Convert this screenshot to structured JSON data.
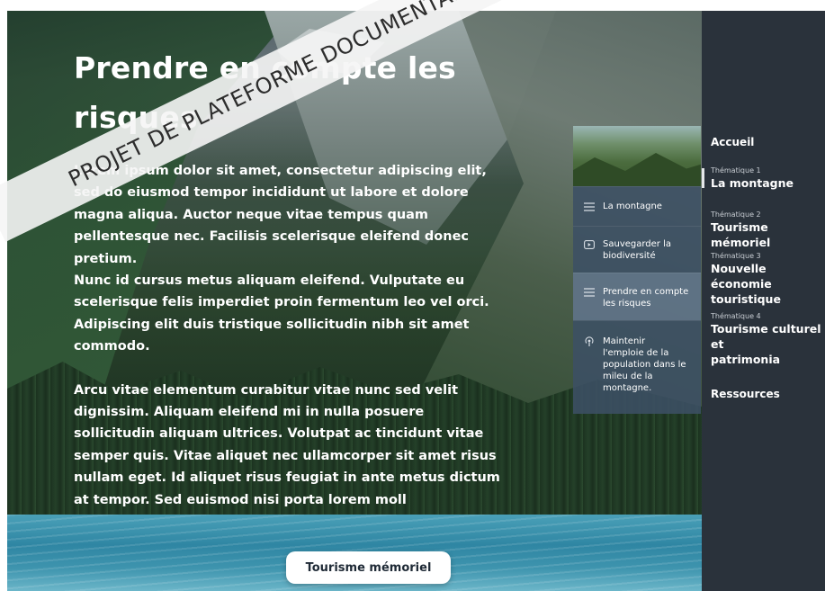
{
  "main": {
    "title": "Prendre en compte les risques",
    "paragraph_1": "Lorem ipsum dolor sit amet, consectetur adipiscing elit,\nsed do eiusmod tempor incididunt ut labore et dolore\nmagna aliqua. Auctor neque vitae tempus quam\npellentesque nec. Facilisis scelerisque eleifend donec\npretium.\nNunc id cursus metus aliquam eleifend. Vulputate eu\nscelerisque felis imperdiet proin fermentum leo vel orci.\nAdipiscing elit duis tristique sollicitudin nibh sit amet\ncommodo.",
    "paragraph_2": "Arcu vitae elementum curabitur vitae nunc sed velit\ndignissim. Aliquam eleifend mi in nulla posuere\nsollicitudin aliquam ultrices. Volutpat ac tincidunt vitae\nsemper quis. Vitae aliquet nec ullamcorper sit amet risus\nnullam eget. Id aliquet risus feugiat in ante metus dictum\nat tempor. Sed euismod nisi porta lorem moll",
    "bottom_button": "Tourisme mémoriel"
  },
  "menu": {
    "items": [
      {
        "label": "La montagne",
        "icon": "menu-lines-icon"
      },
      {
        "label": "Sauvegarder la\nbiodiversité",
        "icon": "play-icon"
      },
      {
        "label": "Prendre en compte\nles risques",
        "icon": "menu-lines-icon"
      },
      {
        "label": "Maintenir\nl'emploie de la\npopulation dans le\nmileu de la\nmontagne.",
        "icon": "podcast-icon"
      }
    ]
  },
  "sidebar": {
    "home": "Accueil",
    "themes": [
      {
        "small": "Thématique 1",
        "label": "La montagne"
      },
      {
        "small": "Thématique 2",
        "label": "Tourisme mémoriel"
      },
      {
        "small": "Thématique 3",
        "label": "Nouvelle économie\ntouristique"
      },
      {
        "small": "Thématique 4",
        "label": "Tourisme culturel et\npatrimonia"
      }
    ],
    "resources": "Ressources"
  },
  "watermark": "PROJET DE PLATEFORME DOCUMENTAIRE"
}
